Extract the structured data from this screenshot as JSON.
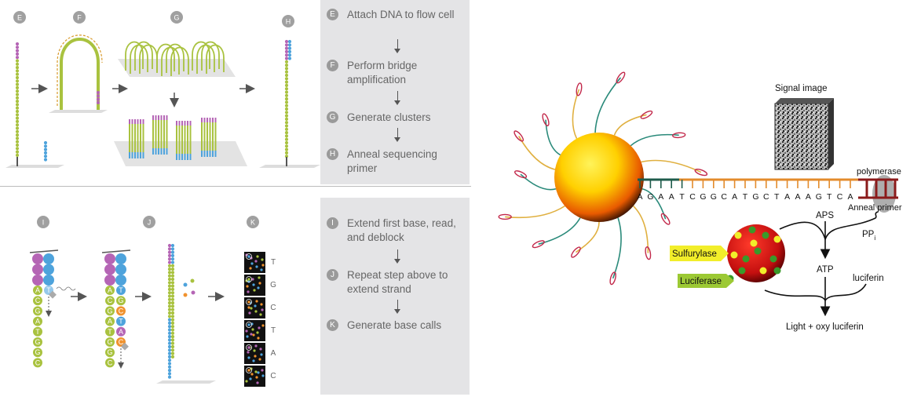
{
  "illumina": {
    "top_labels": [
      "E",
      "F",
      "G",
      "H"
    ],
    "bottom_labels": [
      "I",
      "J",
      "K"
    ],
    "top_steps": [
      {
        "badge": "E",
        "text": "Attach DNA to flow cell"
      },
      {
        "badge": "F",
        "text": "Perform bridge amplification"
      },
      {
        "badge": "G",
        "text": "Generate clusters"
      },
      {
        "badge": "H",
        "text": "Anneal sequencing primer"
      }
    ],
    "bottom_steps": [
      {
        "badge": "I",
        "text": "Extend first base, read, and deblock"
      },
      {
        "badge": "J",
        "text": "Repeat step above to extend strand"
      },
      {
        "badge": "K",
        "text": "Generate base calls"
      }
    ],
    "template_I": [
      "A",
      "C",
      "G",
      "A",
      "T",
      "G",
      "G",
      "C"
    ],
    "added_I": [
      "T"
    ],
    "template_J": [
      "A",
      "C",
      "G",
      "A",
      "T",
      "G",
      "G",
      "C"
    ],
    "added_J": [
      "T",
      "G",
      "C",
      "T",
      "A",
      "C"
    ],
    "base_calls": [
      "T",
      "G",
      "C",
      "T",
      "A",
      "C"
    ],
    "colors": {
      "A": "#b565b5",
      "T": "#4ea3dc",
      "G": "#a9c23f",
      "C": "#f0922e",
      "template": "#a9c23f",
      "primer": "#4ea3dc",
      "adapter": "#b565b5",
      "panel": "#e4e4e6"
    }
  },
  "pyro": {
    "signal_image_label": "Signal image",
    "sequence": [
      "A",
      "G",
      "A",
      "A",
      "T",
      "C",
      "G",
      "G",
      "C",
      "A",
      "T",
      "G",
      "C",
      "T",
      "A",
      "A",
      "A",
      "G",
      "T",
      "C",
      "A"
    ],
    "polymerase_label": "polymerase",
    "anneal_primer_label": "Anneal primer",
    "aps_label": "APS",
    "ppi_label": "PP",
    "ppi_sub": "i",
    "atp_label": "ATP",
    "luciferin_label": "luciferin",
    "product_label": "Light + oxy luciferin",
    "sulfurylase_label": "Sulfurylase",
    "luciferase_label": "Luciferase",
    "colors": {
      "bead": "#ffcc00",
      "enzyme_bead": "#d01818",
      "sulfurylase": "#f2ee2a",
      "luciferase": "#9cc934",
      "backbone": "#e38b2c",
      "polymerase": "#8b1a1a"
    }
  }
}
